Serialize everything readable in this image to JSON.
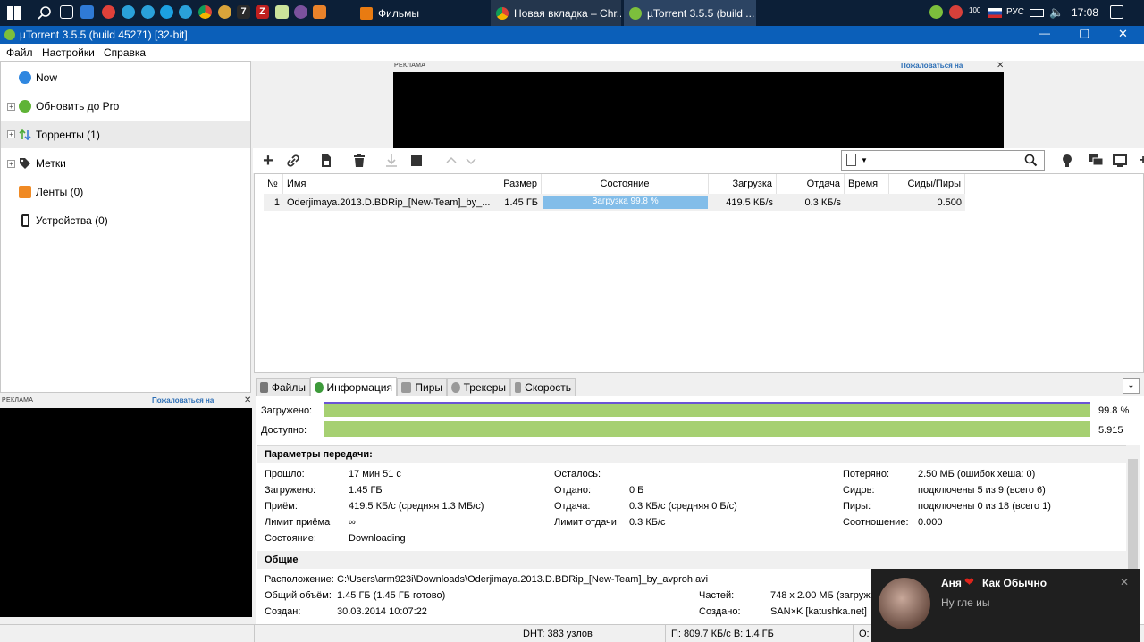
{
  "taskbar": {
    "tasks": [
      "Фильмы",
      "Новая вкладка – Chr...",
      "µTorrent 3.5.5  (build ..."
    ],
    "tray_badge": "100",
    "language": "РУС",
    "clock": "17:08"
  },
  "window": {
    "title": "µTorrent 3.5.5  (build 45271) [32-bit]",
    "minimize": "—",
    "maximize": "▢",
    "close": "✕"
  },
  "menu": [
    "Файл",
    "Настройки",
    "Справка"
  ],
  "sidebar": {
    "items": [
      {
        "label": "Now"
      },
      {
        "label": "Обновить до Pro"
      },
      {
        "label": "Торренты (1)"
      },
      {
        "label": "Метки"
      },
      {
        "label": "Ленты (0)"
      },
      {
        "label": "Устройства (0)"
      }
    ]
  },
  "ads": {
    "top": {
      "label": "РЕКЛАМА",
      "report": "Пожаловаться на",
      "close": "✕"
    },
    "side": {
      "label": "РЕКЛАМА",
      "report": "Пожаловаться на",
      "close": "✕"
    }
  },
  "table": {
    "columns": [
      "№",
      "Имя",
      "Размер",
      "Состояние",
      "Загрузка",
      "Отдача",
      "Время",
      "Сиды/Пиры"
    ],
    "rows": [
      {
        "num": "1",
        "name": "Oderjimaya.2013.D.BDRip_[New-Team]_by_...",
        "size": "1.45 ГБ",
        "status": "Загрузка 99.8 %",
        "progress": 0.998,
        "down": "419.5 КБ/s",
        "up": "0.3 КБ/s",
        "time": "",
        "ratio": "0.500"
      }
    ]
  },
  "tabs": [
    "Файлы",
    "Информация",
    "Пиры",
    "Трекеры",
    "Скорость"
  ],
  "info": {
    "downloaded_label": "Загружено:",
    "downloaded_pct": "99.8 %",
    "available_label": "Доступно:",
    "available_val": "5.915",
    "transfer_title": "Параметры передачи:",
    "transfer": {
      "elapsed_l": "Прошло:",
      "elapsed_v": "17 мин 51 с",
      "downloaded_l": "Загружено:",
      "downloaded_v": "1.45 ГБ",
      "recv_l": "Приём:",
      "recv_v": "419.5 КБ/с (средняя 1.3 МБ/с)",
      "recv_limit_l": "Лимит приёма",
      "recv_limit_v": "∞",
      "state_l": "Состояние:",
      "state_v": "Downloading",
      "left_l": "Осталось:",
      "left_v": "",
      "sent_l": "Отдано:",
      "sent_v": "0 Б",
      "send_l": "Отдача:",
      "send_v": "0.3 КБ/с (средняя 0 Б/с)",
      "send_limit_l": "Лимит отдачи",
      "send_limit_v": "0.3 КБ/с",
      "wasted_l": "Потеряно:",
      "wasted_v": "2.50 МБ (ошибок хеша: 0)",
      "seeds_l": "Сидов:",
      "seeds_v": "подключены 5 из 9 (всего 6)",
      "peers_l": "Пиры:",
      "peers_v": "подключены 0 из 18 (всего 1)",
      "ratio_l": "Соотношение:",
      "ratio_v": "0.000"
    },
    "general_title": "Общие",
    "general": {
      "path_l": "Расположение:",
      "path_v": "C:\\Users\\arm923i\\Downloads\\Oderjimaya.2013.D.BDRip_[New-Team]_by_avproh.avi",
      "total_l": "Общий объём:",
      "total_v": "1.45 ГБ (1.45 ГБ готово)",
      "created_l": "Создан:",
      "created_v": "30.03.2014 10:07:22",
      "pieces_l": "Частей:",
      "pieces_v": "748 x 2.00 МБ (загруже",
      "createdby_l": "Создано:",
      "createdby_v": "SAN×K [katushka.net]"
    }
  },
  "statusbar": {
    "dht": "DHT: 383 узлов",
    "speed": "П: 809.7 КБ/с В: 1.4 ГБ",
    "other": "О:"
  },
  "notification": {
    "sender": "Аня",
    "sender_suffix": "Как Обычно",
    "message": "Ну гле иы",
    "close": "✕"
  },
  "colors": {
    "taskbar": "#0c1f37",
    "titlebar": "#0b5fb9",
    "progress_green": "#a6d072",
    "progress_blue": "#6b54d6",
    "status_blue": "#82bde9"
  }
}
